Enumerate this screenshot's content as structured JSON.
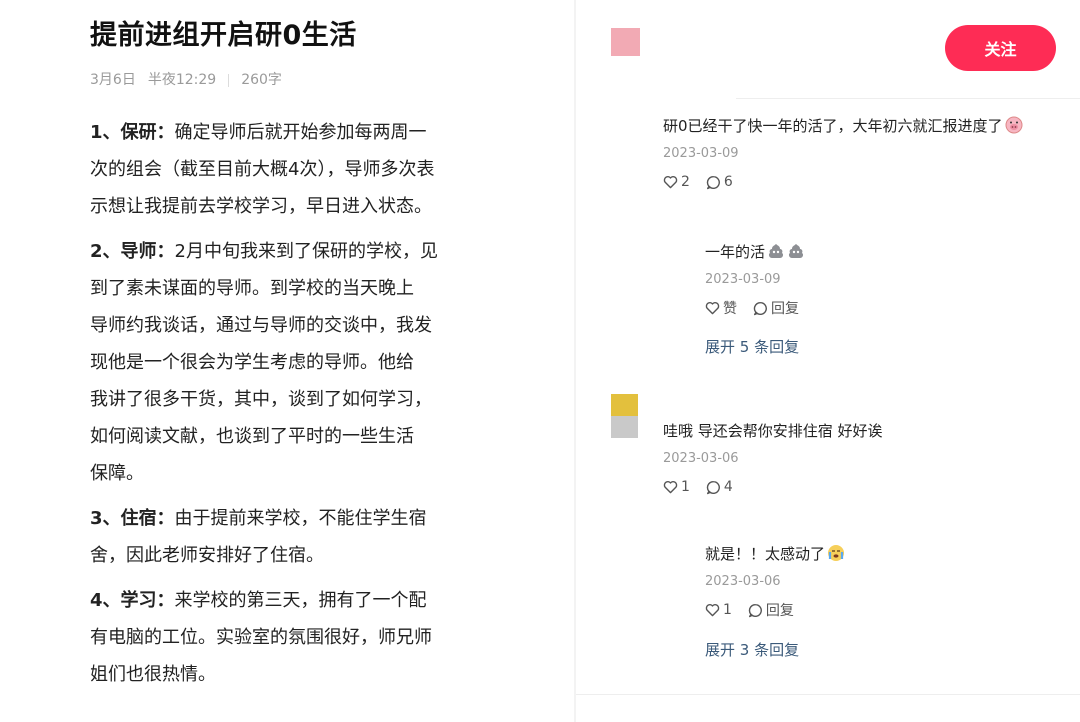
{
  "article": {
    "title": "提前进组开启研0生活",
    "date": "3月6日",
    "time": "半夜12:29",
    "word_count": "260字",
    "paragraphs": [
      {
        "head": "1、保研：",
        "lines": [
          "确定导师后就开始参加每两周一",
          "次的组会（截至目前大概4次），导师多次表",
          "示想让我提前去学校学习，早日进入状态。"
        ]
      },
      {
        "head": "2、导师：",
        "lines": [
          "2月中旬我来到了保研的学校，见",
          "到了素未谋面的导师。到学校的当天晚上",
          "导师约我谈话，通过与导师的交谈中，我发",
          "现他是一个很会为学生考虑的导师。他给",
          "我讲了很多干货，其中，谈到了如何学习，",
          "如何阅读文献，也谈到了平时的一些生活",
          "保障。"
        ]
      },
      {
        "head": "3、住宿：",
        "lines": [
          "由于提前来学校，不能住学生宿",
          "舍，因此老师安排好了住宿。"
        ]
      },
      {
        "head": "4、学习：",
        "lines": [
          "来学校的第三天，拥有了一个配",
          "有电脑的工位。实验室的氛围很好，师兄师",
          "姐们也很热情。"
        ]
      }
    ]
  },
  "header": {
    "follow_label": "关注",
    "avatar_color": "#f2aab4",
    "follow_color": "#fe2c55"
  },
  "comments": [
    {
      "text": "研0已经干了快一年的活了，大年初六就汇报进度了",
      "emoji": "pig-emoji",
      "date": "2023-03-09",
      "likes": "2",
      "replies": "6"
    },
    {
      "text": "一年的活",
      "emoji": "poop-emoji",
      "date": "2023-03-09",
      "likes": "赞",
      "replies": "回复",
      "expand": "展开 5 条回复"
    },
    {
      "text": "哇哦 导还会帮你安排住宿 好好诶",
      "date": "2023-03-06",
      "likes": "1",
      "replies": "4"
    },
    {
      "text": "就是！！太感动了",
      "emoji": "cry-emoji",
      "date": "2023-03-06",
      "likes": "1",
      "replies": "回复",
      "expand": "展开 3 条回复"
    }
  ],
  "colors": {
    "link": "#3b5a7a",
    "muted": "#9a9a9a"
  }
}
